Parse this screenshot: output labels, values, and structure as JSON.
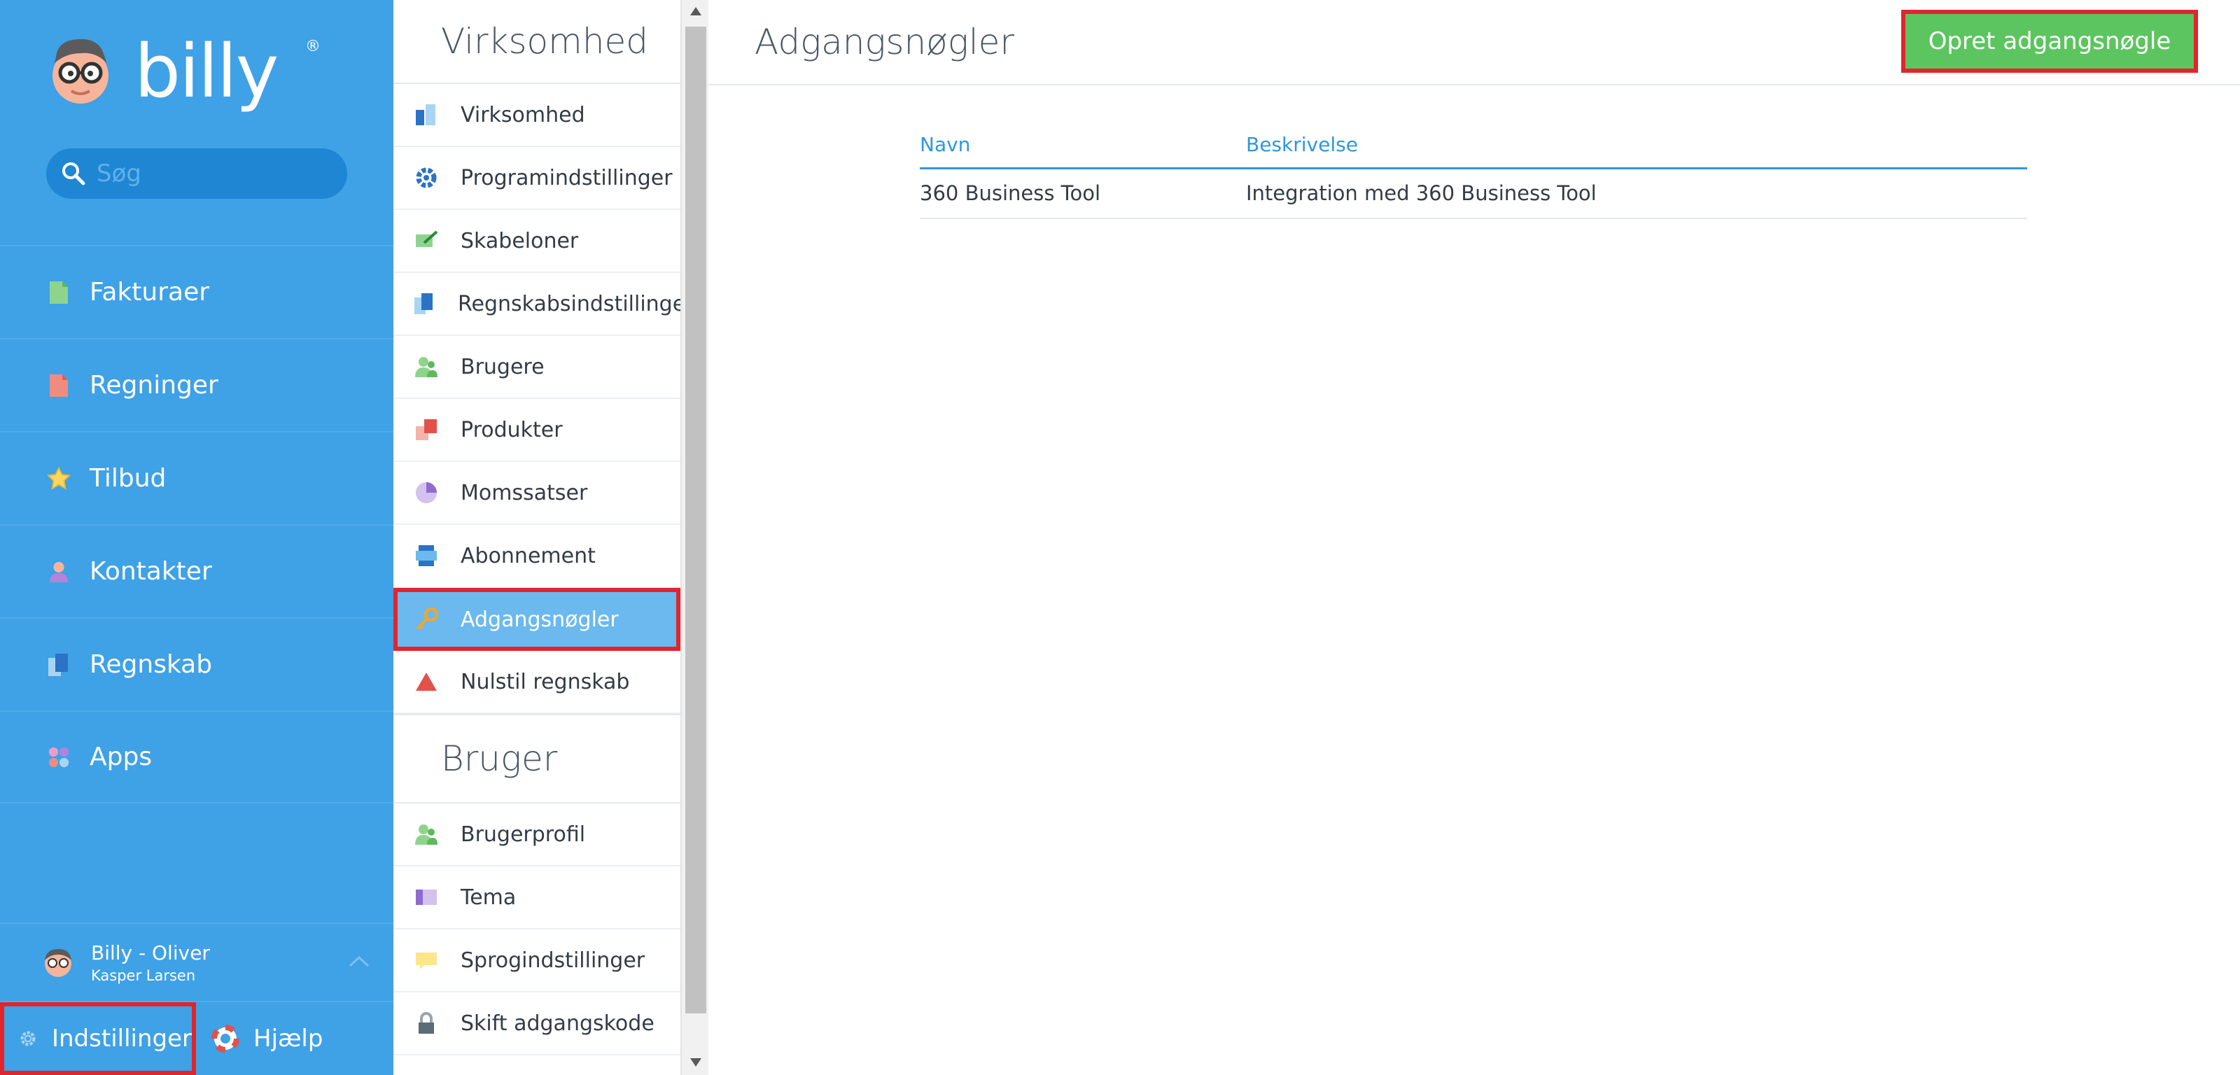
{
  "sidebar": {
    "logo_text": "billy",
    "logo_registered": "®",
    "search_placeholder": "Søg",
    "nav_items": [
      {
        "label": "Fakturaer",
        "icon": "invoice-icon",
        "color": "#8fd48d"
      },
      {
        "label": "Regninger",
        "icon": "bill-icon",
        "color": "#f08c7f"
      },
      {
        "label": "Tilbud",
        "icon": "star-icon",
        "color": "#fbd85a"
      },
      {
        "label": "Kontakter",
        "icon": "contact-icon",
        "color": "#b284d9"
      },
      {
        "label": "Regnskab",
        "icon": "ledger-icon",
        "color": "#2a73c7"
      },
      {
        "label": "Apps",
        "icon": "apps-icon",
        "color": "#f09cc8"
      }
    ],
    "profile": {
      "company": "Billy - Oliver",
      "user": "Kasper Larsen"
    },
    "settings_label": "Indstillinger",
    "help_label": "Hjælp"
  },
  "submenu": {
    "company_heading": "Virksomhed",
    "company_items": [
      {
        "label": "Virksomhed",
        "icon": "company-icon"
      },
      {
        "label": "Programindstillinger",
        "icon": "gear-icon"
      },
      {
        "label": "Skabeloner",
        "icon": "template-icon"
      },
      {
        "label": "Regnskabsindstillinger",
        "icon": "accounting-icon"
      },
      {
        "label": "Brugere",
        "icon": "users-icon"
      },
      {
        "label": "Produkter",
        "icon": "products-icon"
      },
      {
        "label": "Momssatser",
        "icon": "vat-icon"
      },
      {
        "label": "Abonnement",
        "icon": "subscription-icon"
      },
      {
        "label": "Adgangsnøgler",
        "icon": "key-icon"
      },
      {
        "label": "Nulstil regnskab",
        "icon": "reset-icon"
      }
    ],
    "user_heading": "Bruger",
    "user_items": [
      {
        "label": "Brugerprofil",
        "icon": "user-profile-icon"
      },
      {
        "label": "Tema",
        "icon": "theme-icon"
      },
      {
        "label": "Sprogindstillinger",
        "icon": "language-icon"
      },
      {
        "label": "Skift adgangskode",
        "icon": "lock-icon"
      }
    ]
  },
  "main": {
    "title": "Adgangsnøgler",
    "create_button": "Opret adgangsnøgle",
    "table": {
      "columns": [
        "Navn",
        "Beskrivelse"
      ],
      "rows": [
        [
          "360 Business Tool",
          "Integration med 360 Business Tool"
        ]
      ]
    }
  },
  "colors": {
    "sidebar_bg": "#3fa1e6",
    "active_item_bg": "#6bb9ee",
    "create_button_bg": "#5cc55f",
    "highlight_border": "#e2242c",
    "table_header": "#2f97dd"
  }
}
